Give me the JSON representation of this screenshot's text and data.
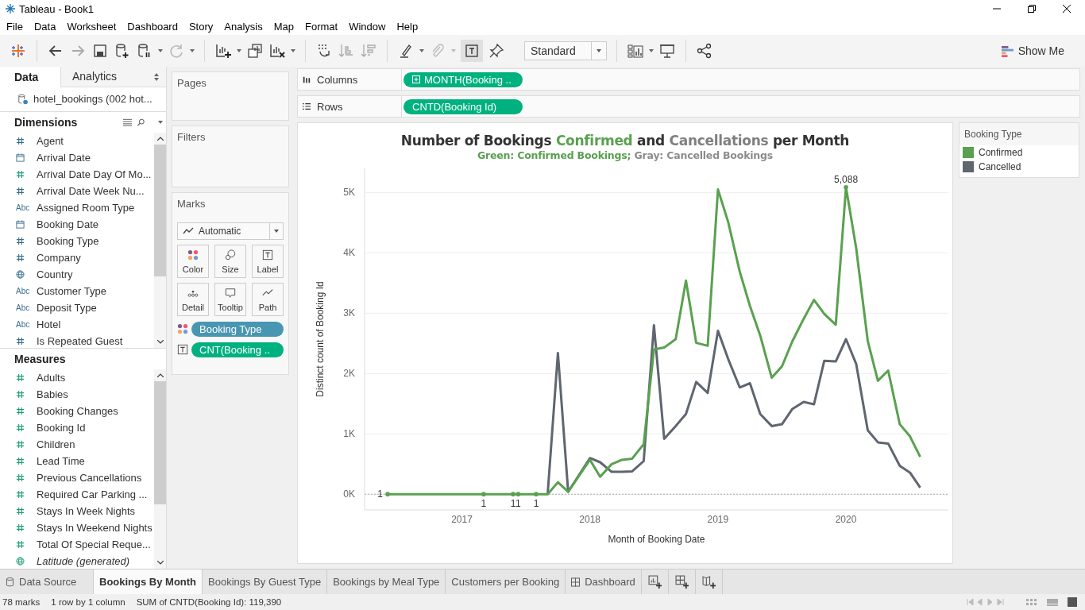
{
  "window": {
    "title": "Tableau - Book1"
  },
  "menu": [
    "File",
    "Data",
    "Worksheet",
    "Dashboard",
    "Story",
    "Analysis",
    "Map",
    "Format",
    "Window",
    "Help"
  ],
  "toolbar": {
    "fit_select": "Standard",
    "show_me": "Show Me"
  },
  "data_tabs": [
    {
      "label": "Data",
      "selected": true
    },
    {
      "label": "Analytics",
      "selected": false
    }
  ],
  "data_source": "hotel_bookings (002 hot...",
  "dimensions": {
    "title": "Dimensions",
    "items": [
      {
        "name": "Agent",
        "kind": "number",
        "continuous": false,
        "generated": false
      },
      {
        "name": "Arrival Date",
        "kind": "date",
        "continuous": false,
        "generated": false
      },
      {
        "name": "Arrival Date Day Of Mo...",
        "kind": "number",
        "continuous": true,
        "generated": false
      },
      {
        "name": "Arrival Date Week Nu...",
        "kind": "number",
        "continuous": false,
        "generated": false
      },
      {
        "name": "Assigned Room Type",
        "kind": "string",
        "icon": "Abc",
        "continuous": false,
        "generated": false
      },
      {
        "name": "Booking Date",
        "kind": "date",
        "continuous": false,
        "generated": false
      },
      {
        "name": "Booking Type",
        "kind": "number",
        "continuous": false,
        "generated": false
      },
      {
        "name": "Company",
        "kind": "number",
        "continuous": false,
        "generated": false
      },
      {
        "name": "Country",
        "kind": "geo",
        "continuous": false,
        "generated": false
      },
      {
        "name": "Customer Type",
        "kind": "string",
        "icon": "Abc",
        "continuous": false,
        "generated": false
      },
      {
        "name": "Deposit Type",
        "kind": "string",
        "icon": "Abc",
        "continuous": false,
        "generated": false
      },
      {
        "name": "Hotel",
        "kind": "string",
        "icon": "Abc",
        "continuous": false,
        "generated": false
      },
      {
        "name": "Is Repeated Guest",
        "kind": "number",
        "continuous": false,
        "generated": false
      }
    ]
  },
  "measures": {
    "title": "Measures",
    "items": [
      {
        "name": "Adults",
        "kind": "number",
        "continuous": true,
        "generated": false
      },
      {
        "name": "Babies",
        "kind": "number",
        "continuous": true,
        "generated": false
      },
      {
        "name": "Booking Changes",
        "kind": "number",
        "continuous": true,
        "generated": false
      },
      {
        "name": "Booking Id",
        "kind": "number",
        "continuous": true,
        "generated": false
      },
      {
        "name": "Children",
        "kind": "number",
        "continuous": true,
        "generated": false
      },
      {
        "name": "Lead Time",
        "kind": "number",
        "continuous": true,
        "generated": false
      },
      {
        "name": "Previous Cancellations",
        "kind": "number",
        "continuous": true,
        "generated": false
      },
      {
        "name": "Required Car Parking ...",
        "kind": "number",
        "continuous": true,
        "generated": false
      },
      {
        "name": "Stays In Week Nights",
        "kind": "number",
        "continuous": true,
        "generated": false
      },
      {
        "name": "Stays In Weekend Nights",
        "kind": "number",
        "continuous": true,
        "generated": false
      },
      {
        "name": "Total Of Special Reque...",
        "kind": "number",
        "continuous": true,
        "generated": false
      },
      {
        "name": "Latitude (generated)",
        "kind": "geo",
        "continuous": true,
        "generated": true
      }
    ]
  },
  "pages": {
    "title": "Pages"
  },
  "filters": {
    "title": "Filters"
  },
  "marks": {
    "title": "Marks",
    "type": "Automatic",
    "cards": [
      {
        "label": "Color",
        "kind": "color"
      },
      {
        "label": "Size",
        "kind": "size"
      },
      {
        "label": "Label",
        "kind": "label"
      },
      {
        "label": "Detail",
        "kind": "detail"
      },
      {
        "label": "Tooltip",
        "kind": "tooltip"
      },
      {
        "label": "Path",
        "kind": "path"
      }
    ],
    "pills": [
      {
        "label": "Booking Type",
        "kind": "color",
        "continuous": false
      },
      {
        "label": "CNT(Booking ..",
        "kind": "label",
        "continuous": true
      }
    ]
  },
  "shelves": [
    {
      "label": "Columns",
      "kind": "columns",
      "pill": "MONTH(Booking ..",
      "expandable": true,
      "continuous": true
    },
    {
      "label": "Rows",
      "kind": "rows",
      "pill": "CNTD(Booking Id)",
      "expandable": false,
      "continuous": true
    }
  ],
  "view": {
    "title_parts": [
      {
        "text": "Number of Bookings ",
        "color": "#333333"
      },
      {
        "text": "Confirmed",
        "color": "#59a14f"
      },
      {
        "text": " and ",
        "color": "#333333"
      },
      {
        "text": "Cancellations",
        "color": "#7f7f7f"
      },
      {
        "text": " per Month",
        "color": "#333333"
      }
    ],
    "subtitle_parts": [
      {
        "text": "Green: Confirmed Bookings;",
        "color": "#59a14f"
      },
      {
        "text": " Gray: Cancelled Bookings",
        "color": "#8c8c8c"
      }
    ],
    "chart_data": {
      "type": "line",
      "xlabel": "Month of Booking Date",
      "ylabel": "Distinct count of Booking Id",
      "x": [
        2016.42,
        2017.17,
        2017.42,
        2017.58,
        2017.67,
        2017.75,
        2017.83,
        2018.0,
        2018.08,
        2018.17,
        2018.25,
        2018.33,
        2018.42,
        2018.5,
        2018.58,
        2018.67,
        2018.75,
        2018.83,
        2018.92,
        2019.0,
        2019.08,
        2019.17,
        2019.25,
        2019.33,
        2019.42,
        2019.5,
        2019.58,
        2019.67,
        2019.75,
        2019.83,
        2019.92,
        2020.0,
        2020.08,
        2020.17,
        2020.25,
        2020.33,
        2020.42,
        2020.5,
        2020.58
      ],
      "series": [
        {
          "name": "Confirmed",
          "color": "#59a14f",
          "values": [
            1,
            1,
            1,
            1,
            0,
            200,
            40,
            570,
            290,
            500,
            570,
            590,
            830,
            2400,
            2430,
            2570,
            3540,
            2510,
            2460,
            5050,
            4510,
            3690,
            3120,
            2630,
            1930,
            2120,
            2530,
            2910,
            3220,
            2990,
            2810,
            5088,
            4080,
            2540,
            1880,
            2050,
            1160,
            960,
            620
          ]
        },
        {
          "name": "Cancelled",
          "color": "#5f6670",
          "values": [
            null,
            null,
            null,
            null,
            0,
            2340,
            40,
            600,
            530,
            370,
            370,
            380,
            550,
            2800,
            920,
            1130,
            1330,
            1860,
            1680,
            2710,
            2240,
            1770,
            1840,
            1330,
            1130,
            1160,
            1410,
            1530,
            1490,
            2210,
            2200,
            2570,
            2160,
            1060,
            860,
            840,
            470,
            360,
            110
          ]
        }
      ],
      "xlim": [
        2016.24,
        2020.8
      ],
      "ylim": [
        -260,
        5400
      ],
      "xticks": [
        2017,
        2018,
        2019,
        2020
      ],
      "yticks": [
        {
          "value": 0,
          "label": "0K"
        },
        {
          "value": 1000,
          "label": "1K"
        },
        {
          "value": 2000,
          "label": "2K"
        },
        {
          "value": 3000,
          "label": "3K"
        },
        {
          "value": 4000,
          "label": "4K"
        },
        {
          "value": 5000,
          "label": "5K"
        }
      ],
      "grid": true,
      "ref_lines": [
        {
          "axis": "y",
          "value": 0
        }
      ],
      "annotations": [
        {
          "x": 2016.42,
          "y": 1,
          "text": "1"
        },
        {
          "x": 2017.17,
          "y": 1,
          "text": "1"
        },
        {
          "x": 2017.4,
          "y": 1,
          "text": "1"
        },
        {
          "x": 2017.44,
          "y": 1,
          "text": "1"
        },
        {
          "x": 2017.58,
          "y": 1,
          "text": "1"
        },
        {
          "x": 2020.0,
          "y": 5088,
          "text": "5,088"
        }
      ]
    }
  },
  "legend": {
    "title": "Booking Type"
  },
  "sheet_tabs": [
    {
      "label": "Data Source",
      "kind": "datasource",
      "selected": false
    },
    {
      "label": "Bookings By Month",
      "kind": "sheet",
      "selected": true
    },
    {
      "label": "Bookings By Guest Type",
      "kind": "sheet",
      "selected": false
    },
    {
      "label": "Bookings by Meal Type",
      "kind": "sheet",
      "selected": false
    },
    {
      "label": "Customers per Booking",
      "kind": "sheet",
      "selected": false
    },
    {
      "label": "Dashboard",
      "kind": "dashboard",
      "selected": false
    }
  ],
  "status_bar": [
    "78 marks",
    "1 row by 1 column",
    "SUM of CNTD(Booking Id): 119,390"
  ]
}
